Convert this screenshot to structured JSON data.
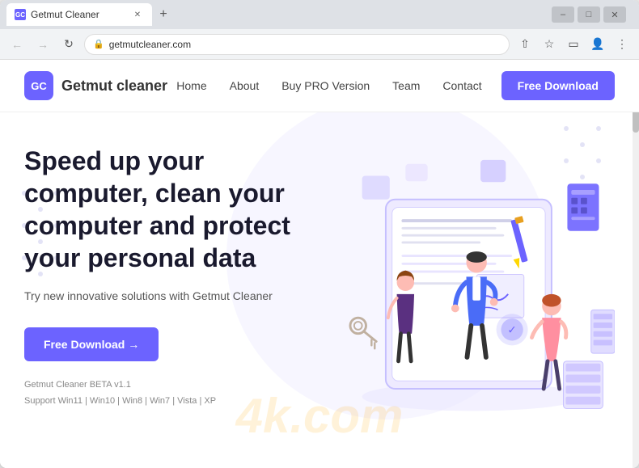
{
  "browser": {
    "title": "Getmut Cleaner",
    "tab_label": "Getmut Cleaner",
    "address": "getmutcleaner.com",
    "new_tab_icon": "+",
    "back_disabled": false,
    "forward_disabled": true
  },
  "site": {
    "logo_initials": "GC",
    "logo_name": "Getmut cleaner",
    "nav": {
      "home": "Home",
      "about": "About",
      "buy_pro": "Buy PRO Version",
      "team": "Team",
      "contact": "Contact",
      "cta_btn": "Free Download"
    },
    "hero": {
      "title": "Speed up your computer, clean your computer and protect your personal data",
      "subtitle": "Try new innovative solutions with Getmut Cleaner",
      "download_btn": "Free Download →",
      "version_line1": "Getmut Cleaner BETA v1.1",
      "version_line2": "Support Win11 | Win10 | Win8 | Win7 | Vista | XP"
    }
  },
  "watermark": "4k.com",
  "colors": {
    "primary": "#6c63ff",
    "text_dark": "#1a1a2e",
    "text_muted": "#888888",
    "bg_light": "#f4f4ff"
  }
}
